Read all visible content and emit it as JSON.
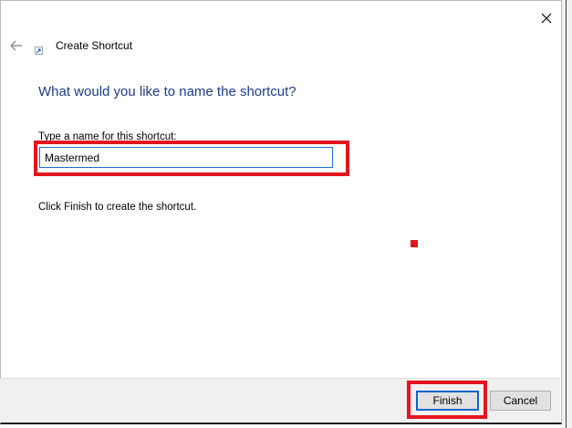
{
  "window": {
    "title": "Create Shortcut",
    "close_icon": "close-icon",
    "back_icon": "back-arrow-icon",
    "app_icon": "shortcut-icon"
  },
  "main": {
    "heading": "What would you like to name the shortcut?",
    "field_label": "Type a name for this shortcut:",
    "name_value": "Mastermed",
    "info": "Click Finish to create the shortcut."
  },
  "footer": {
    "finish_label": "Finish",
    "cancel_label": "Cancel"
  },
  "colors": {
    "heading": "#1c3c8c",
    "annotation_highlight": "#e3161f",
    "focus_border": "#1a6fd6"
  }
}
